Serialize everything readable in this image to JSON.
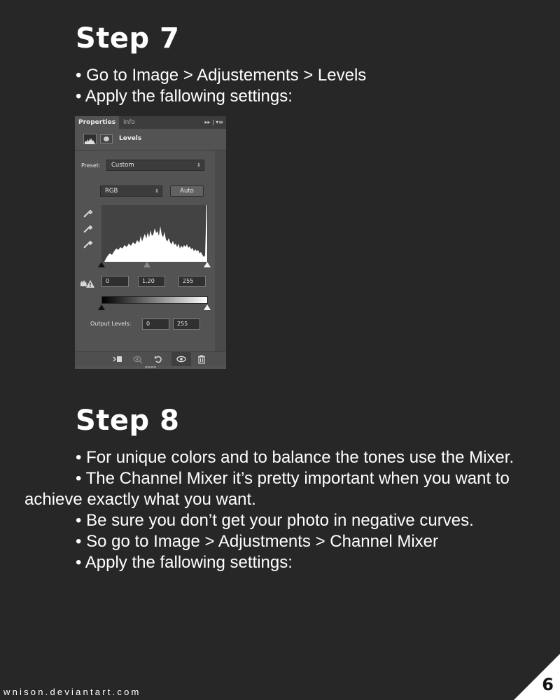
{
  "step7": {
    "title": "Step 7",
    "lines": [
      "•  Go to Image > Adjustements > Levels",
      "•  Apply the fallowing settings:"
    ]
  },
  "panel": {
    "tabs": [
      "Properties",
      "Info"
    ],
    "tab_icons": "▸▸ |  ▾≡",
    "title": "Levels",
    "preset_label": "Preset:",
    "preset_value": "Custom",
    "channel": "RGB",
    "auto_label": "Auto",
    "input_black": "0",
    "input_gamma": "1.20",
    "input_white": "255",
    "output_label": "Output Levels:",
    "output_black": "0",
    "output_white": "255",
    "dropdown_arrows": "⇕"
  },
  "step8": {
    "title": "Step 8",
    "lines": [
      "•  For unique colors and to balance the tones use the Mixer.",
      "•  The Channel Mixer it’s pretty important when you want to",
      "achieve exactly what you want.",
      "•  Be sure you don’t get your photo in negative curves.",
      "•  So go to Image > Adjustments > Channel Mixer",
      "• Apply the fallowing settings:"
    ]
  },
  "footer": {
    "site": "wnison.deviantart.com",
    "page_number": "6"
  }
}
